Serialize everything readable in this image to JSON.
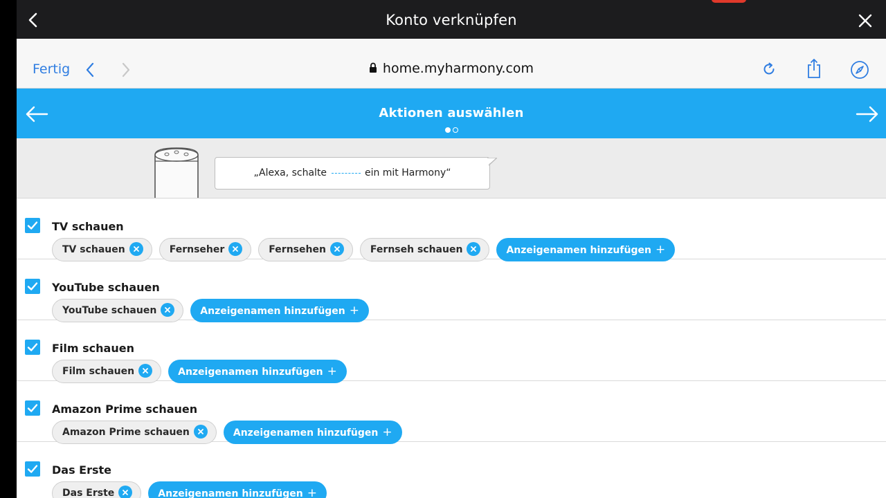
{
  "window": {
    "title": "Konto verknüpfen"
  },
  "browser": {
    "done_label": "Fertig",
    "url": "home.myharmony.com"
  },
  "wizard": {
    "heading": "Aktionen auswählen",
    "page_count": 2,
    "current_page": 1
  },
  "hero": {
    "phrase_before": "„Alexa, schalte",
    "phrase_after": "ein mit Harmony“"
  },
  "activities": [
    {
      "label": "TV schauen",
      "checked": true,
      "names": [
        "TV schauen",
        "Fernseher",
        "Fernsehen",
        "Fernseh schauen"
      ],
      "add_label": "Anzeigenamen hinzufügen"
    },
    {
      "label": "YouTube schauen",
      "checked": true,
      "names": [
        "YouTube schauen"
      ],
      "add_label": "Anzeigenamen hinzufügen"
    },
    {
      "label": "Film schauen",
      "checked": true,
      "names": [
        "Film schauen"
      ],
      "add_label": "Anzeigenamen hinzufügen"
    },
    {
      "label": "Amazon Prime schauen",
      "checked": true,
      "names": [
        "Amazon Prime schauen"
      ],
      "add_label": "Anzeigenamen hinzufügen"
    },
    {
      "label": "Das Erste",
      "checked": true,
      "names": [
        "Das Erste"
      ],
      "add_label": "Anzeigenamen hinzufügen"
    }
  ],
  "icons": {
    "back": "chevron-left-icon",
    "close": "close-icon",
    "lock": "lock-icon",
    "reload": "reload-icon",
    "share": "share-icon",
    "compass": "compass-icon",
    "arrow_left": "arrow-left-icon",
    "arrow_right": "arrow-right-icon",
    "checkbox": "checkmark-icon",
    "remove": "remove-x-icon",
    "add": "plus-icon"
  },
  "colors": {
    "accent": "#1fa9f2",
    "link": "#2f7de1",
    "titlebar": "#1c1c1e"
  }
}
